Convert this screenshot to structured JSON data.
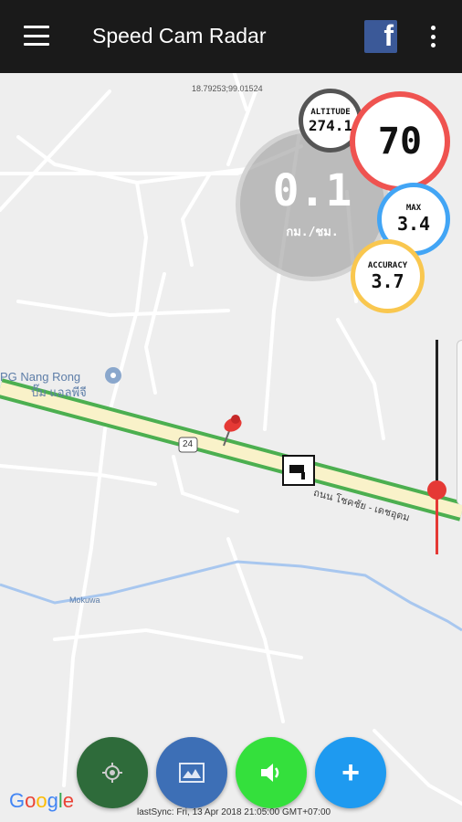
{
  "appbar": {
    "title": "Speed Cam Radar",
    "menu_icon": "hamburger-menu-icon",
    "facebook_label": "f",
    "overflow_icon": "more-vert-icon"
  },
  "map": {
    "coordinates": "18.79253;99.01524",
    "poi_name": "PG Nang Rong",
    "poi_thai": "ปั๊ม แอลพีจี",
    "highway_shield": "24",
    "road_name": "ถนน โชคชัย - เดชอุดม",
    "river_label": "Mokuwa"
  },
  "gauges": {
    "speed_value": "0.1",
    "speed_unit": "กม./ชม.",
    "altitude_label": "ALTITUDE",
    "altitude_value": "274.1",
    "limit_value": "70",
    "max_label": "MAX",
    "max_value": "3.4",
    "accuracy_label": "ACCURACY",
    "accuracy_value": "3.7"
  },
  "fabs": {
    "locate_icon": "target-icon",
    "map_icon": "map-icon",
    "sound_icon": "speaker-icon",
    "add_label": "+"
  },
  "footer": {
    "google": [
      "G",
      "o",
      "o",
      "g",
      "l",
      "e"
    ],
    "last_sync": "lastSync: Fri, 13 Apr 2018 21:05:00 GMT+07:00"
  },
  "colors": {
    "limit": "#ef5350",
    "max": "#42a5f5",
    "accuracy": "#f9c74f",
    "altitude": "#555555",
    "fab_locate": "#2e6b3a",
    "fab_map": "#3d6fb6",
    "fab_sound": "#34e03c",
    "fab_add": "#1e9af0"
  }
}
